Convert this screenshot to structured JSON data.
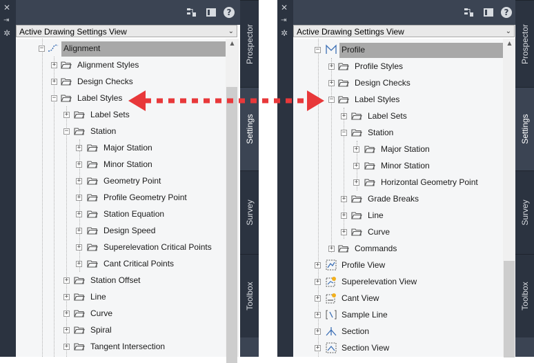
{
  "toolspace": {
    "view_dropdown": "Active Drawing Settings View",
    "help_label": "?",
    "close_glyph": "✕",
    "tabs": {
      "prospector": "Prospector",
      "settings": "Settings",
      "survey": "Survey",
      "toolbox": "Toolbox"
    }
  },
  "left_tree": {
    "rows": [
      {
        "label": "Alignment"
      },
      {
        "label": "Alignment Styles"
      },
      {
        "label": "Design Checks"
      },
      {
        "label": "Label Styles"
      },
      {
        "label": "Label Sets"
      },
      {
        "label": "Station"
      },
      {
        "label": "Major Station"
      },
      {
        "label": "Minor Station"
      },
      {
        "label": "Geometry Point"
      },
      {
        "label": "Profile Geometry Point"
      },
      {
        "label": "Station Equation"
      },
      {
        "label": "Design Speed"
      },
      {
        "label": "Superelevation Critical Points"
      },
      {
        "label": "Cant Critical Points"
      },
      {
        "label": "Station Offset"
      },
      {
        "label": "Line"
      },
      {
        "label": "Curve"
      },
      {
        "label": "Spiral"
      },
      {
        "label": "Tangent Intersection"
      }
    ]
  },
  "right_tree": {
    "rows": [
      {
        "label": "Profile"
      },
      {
        "label": "Profile Styles"
      },
      {
        "label": "Design Checks"
      },
      {
        "label": "Label Styles"
      },
      {
        "label": "Label Sets"
      },
      {
        "label": "Station"
      },
      {
        "label": "Major Station"
      },
      {
        "label": "Minor Station"
      },
      {
        "label": "Horizontal Geometry Point"
      },
      {
        "label": "Grade Breaks"
      },
      {
        "label": "Line"
      },
      {
        "label": "Curve"
      },
      {
        "label": "Commands"
      },
      {
        "label": "Profile View"
      },
      {
        "label": "Superelevation View"
      },
      {
        "label": "Cant View"
      },
      {
        "label": "Sample Line"
      },
      {
        "label": "Section"
      },
      {
        "label": "Section View"
      }
    ]
  },
  "colors": {
    "arrow": "#e8383a",
    "panel_dark": "#3b4453",
    "selection": "#a8a8a8"
  }
}
